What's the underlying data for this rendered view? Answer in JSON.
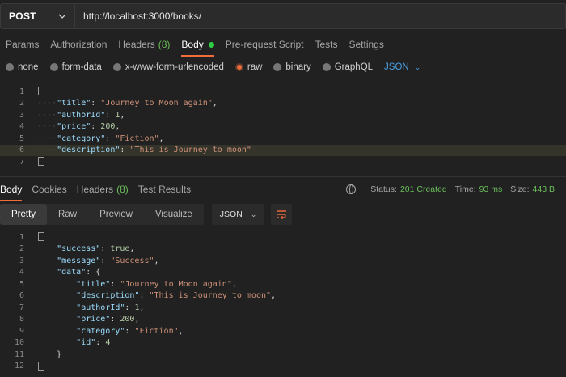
{
  "request": {
    "method": "POST",
    "url": "http://localhost:3000/books/"
  },
  "request_tabs": [
    {
      "label": "Params"
    },
    {
      "label": "Authorization"
    },
    {
      "label": "Headers",
      "count": "(8)"
    },
    {
      "label": "Body",
      "active": true
    },
    {
      "label": "Pre-request Script"
    },
    {
      "label": "Tests"
    },
    {
      "label": "Settings"
    }
  ],
  "body_types": [
    "none",
    "form-data",
    "x-www-form-urlencoded",
    "raw",
    "binary",
    "GraphQL"
  ],
  "body_type_selected": "raw",
  "body_language": "JSON",
  "request_body_lines": [
    "1",
    "2",
    "3",
    "4",
    "5",
    "6",
    "7"
  ],
  "request_body": {
    "title_key": "\"title\"",
    "title_val": "\"Journey to Moon again\"",
    "author_key": "\"authorId\"",
    "author_val": "1",
    "price_key": "\"price\"",
    "price_val": "200",
    "category_key": "\"category\"",
    "category_val": "\"Fiction\"",
    "description_key": "\"description\"",
    "description_val": "\"This is Journey to moon\""
  },
  "response_tabs": [
    {
      "label": "Body",
      "active": true
    },
    {
      "label": "Cookies"
    },
    {
      "label": "Headers",
      "count": "(8)"
    },
    {
      "label": "Test Results"
    }
  ],
  "response_status": {
    "status_label": "Status:",
    "status_value": "201 Created",
    "time_label": "Time:",
    "time_value": "93 ms",
    "size_label": "Size:",
    "size_value": "443 B"
  },
  "response_views": [
    "Pretty",
    "Raw",
    "Preview",
    "Visualize"
  ],
  "response_format": "JSON",
  "response_body": {
    "success_key": "\"success\"",
    "success_val": "true",
    "message_key": "\"message\"",
    "message_val": "\"Success\"",
    "data_key": "\"data\"",
    "title_key": "\"title\"",
    "title_val": "\"Journey to Moon again\"",
    "description_key": "\"description\"",
    "description_val": "\"This is Journey to moon\"",
    "author_key": "\"authorId\"",
    "author_val": "1",
    "price_key": "\"price\"",
    "price_val": "200",
    "category_key": "\"category\"",
    "category_val": "\"Fiction\"",
    "id_key": "\"id\"",
    "id_val": "4"
  },
  "response_body_lines": [
    "1",
    "2",
    "3",
    "4",
    "5",
    "6",
    "7",
    "8",
    "9",
    "10",
    "11",
    "12"
  ],
  "colors": {
    "accent": "#f26b3a",
    "status_green": "#6bbd5b",
    "json_key": "#9cdcfe",
    "json_string": "#ce9178"
  }
}
